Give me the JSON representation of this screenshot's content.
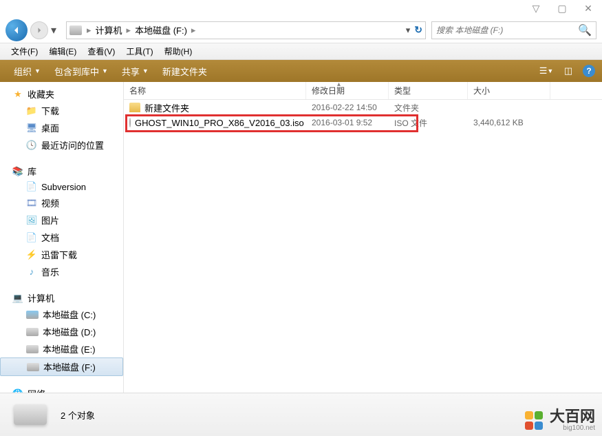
{
  "window_controls": {
    "min": "▽",
    "max": "▢",
    "close": "✕"
  },
  "nav": {
    "breadcrumb": [
      "计算机",
      "本地磁盘 (F:)"
    ],
    "search_placeholder": "搜索 本地磁盘 (F:)"
  },
  "menu": [
    "文件(F)",
    "编辑(E)",
    "查看(V)",
    "工具(T)",
    "帮助(H)"
  ],
  "toolbar": {
    "organize": "组织",
    "include": "包含到库中",
    "share": "共享",
    "new_folder": "新建文件夹"
  },
  "sidebar": {
    "favorites": {
      "label": "收藏夹",
      "items": [
        "下载",
        "桌面",
        "最近访问的位置"
      ]
    },
    "libraries": {
      "label": "库",
      "items": [
        "Subversion",
        "视频",
        "图片",
        "文档",
        "迅雷下载",
        "音乐"
      ]
    },
    "computer": {
      "label": "计算机",
      "items": [
        "本地磁盘 (C:)",
        "本地磁盘 (D:)",
        "本地磁盘 (E:)",
        "本地磁盘 (F:)"
      ]
    },
    "network": {
      "label": "网络"
    }
  },
  "columns": {
    "name": "名称",
    "date": "修改日期",
    "type": "类型",
    "size": "大小"
  },
  "files": [
    {
      "name": "新建文件夹",
      "date": "2016-02-22 14:50",
      "type": "文件夹",
      "size": "",
      "icon": "folder"
    },
    {
      "name": "GHOST_WIN10_PRO_X86_V2016_03.iso",
      "date": "2016-03-01 9:52",
      "type": "ISO 文件",
      "size": "3,440,612 KB",
      "icon": "disc"
    }
  ],
  "status": {
    "count": "2 个对象"
  },
  "watermark": {
    "main": "大百网",
    "sub": "big100.net"
  }
}
